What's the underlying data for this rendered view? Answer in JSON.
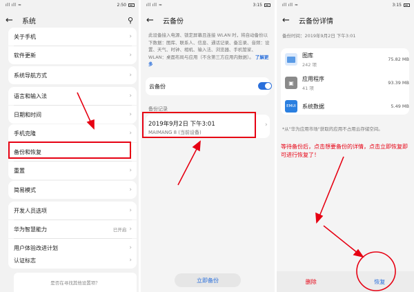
{
  "panel1": {
    "status": {
      "signal": "ıll ıll ≈",
      "time": "2:50"
    },
    "title": "系统",
    "items": [
      {
        "label": "关于手机",
        "value": ""
      },
      {
        "label": "软件更新",
        "value": ""
      },
      {
        "label": "系统导航方式",
        "value": ""
      },
      {
        "label": "语言和输入法",
        "value": ""
      },
      {
        "label": "日期和时间",
        "value": ""
      },
      {
        "label": "手机克隆",
        "value": ""
      },
      {
        "label": "备份和恢复",
        "value": ""
      },
      {
        "label": "重置",
        "value": ""
      },
      {
        "label": "简易模式",
        "value": ""
      },
      {
        "label": "开发人员选项",
        "value": ""
      },
      {
        "label": "华为智慧能力",
        "value": "已开启"
      },
      {
        "label": "用户体验改进计划",
        "value": ""
      },
      {
        "label": "认证标志",
        "value": ""
      }
    ],
    "search_hint": "是否在寻找其他设置项？"
  },
  "panel2": {
    "status": {
      "signal": "ıll ıll ≈",
      "time": "3:15"
    },
    "title": "云备份",
    "description": "此设备接入电源、锁定屏幕且连接 WLAN 时，将自动备份以下数据：图库、联系人、信息、通话记录、备忘录、音频：设置、天气、时钟、相机、输入法、浏览器、手机管家、WLAN：桌面布局与应用（不含第三方应用内数据）。",
    "more": "了解更多",
    "cloud_backup_label": "云备份",
    "records_label": "备份记录",
    "record_date": "2019年9月2日 下午3:01",
    "record_device": "MAIMANG 8 (当前设备)",
    "backup_now": "立即备份"
  },
  "panel3": {
    "status": {
      "signal": "ıll ıll ≈",
      "time": "3:15"
    },
    "title": "云备份详情",
    "backup_time": "备份时间：2019年9月2日 下午3:01",
    "apps": [
      {
        "name": "图库",
        "count": "242 项",
        "size": "75.82 MB",
        "icon": "gallery-icon",
        "color": "#5a9be6"
      },
      {
        "name": "应用程序",
        "count": "41 项",
        "size": "93.39 MB",
        "icon": "android-icon",
        "color": "#888888"
      },
      {
        "name": "系统数据",
        "count": "",
        "size": "5.49 MB",
        "icon": "emui-icon",
        "color": "#2a7fe0"
      }
    ],
    "emui_text": "EMUI",
    "note": "*从\"华为应用市场\"获取的应用不占用云存储空间。",
    "annotation": "等待备份后，点击想要备份的详情，点击立即恢复即可进行恢复了！",
    "delete_label": "删除",
    "restore_label": "恢复"
  },
  "colors": {
    "accent": "#2a6fdb",
    "annotation": "#e60012"
  }
}
